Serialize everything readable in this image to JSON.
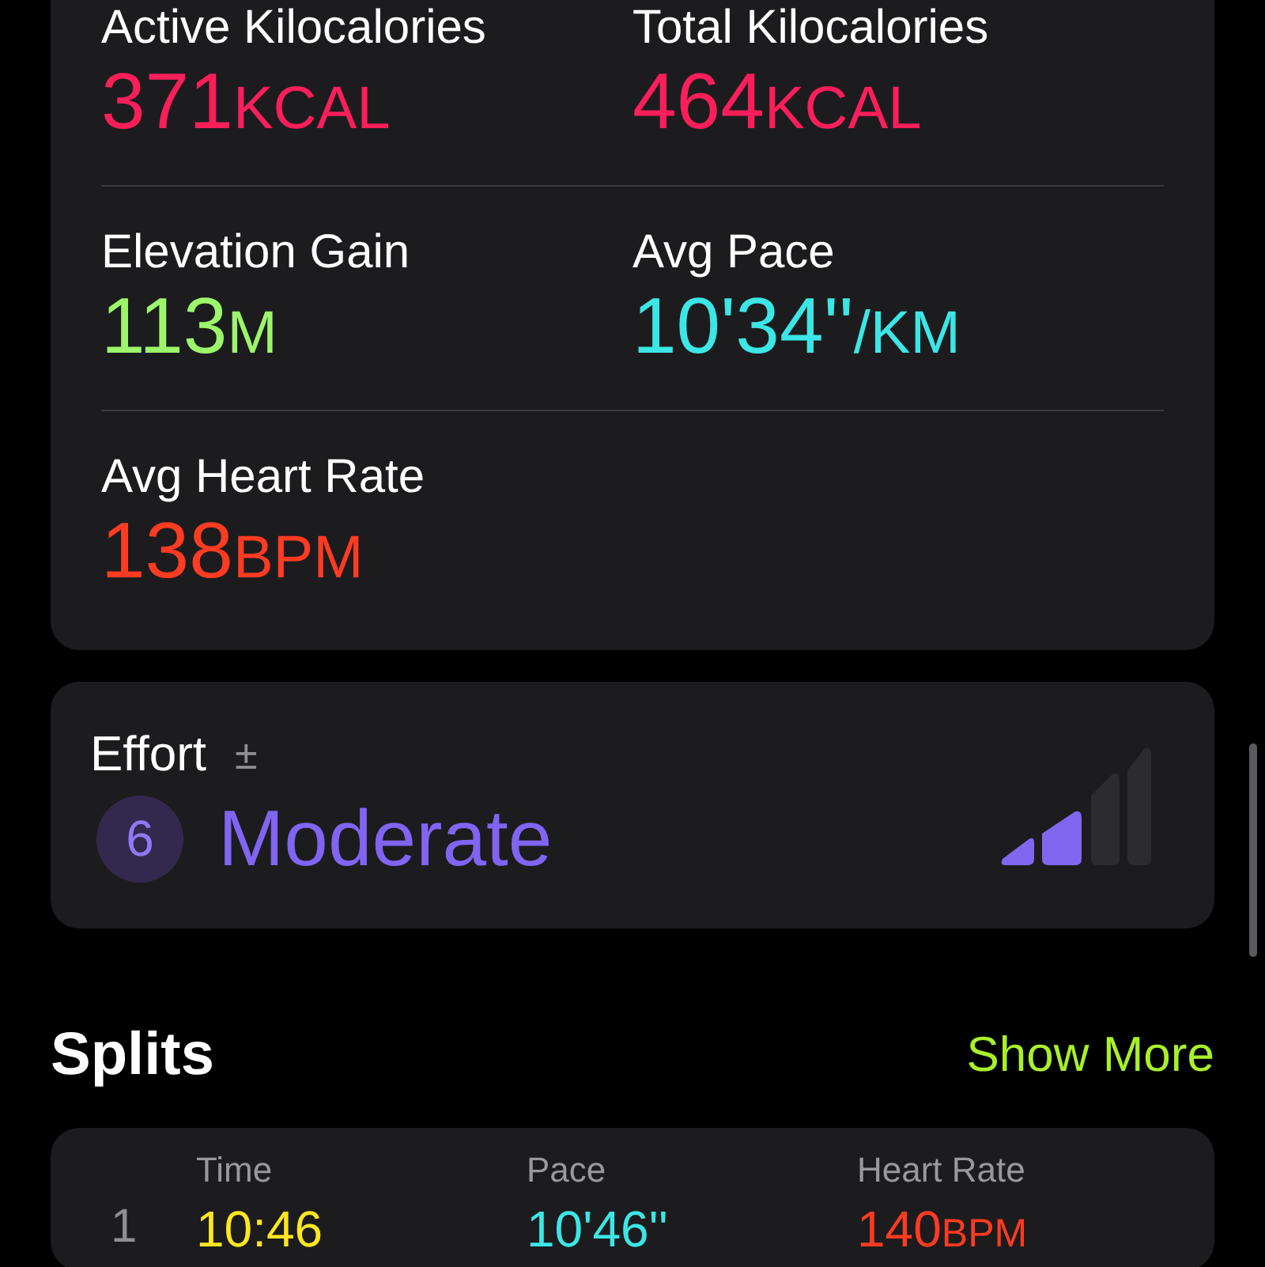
{
  "metrics": [
    {
      "label": "Active Kilocalories",
      "value": "371",
      "unit": "KCAL",
      "color": "#fa1e5a"
    },
    {
      "label": "Total Kilocalories",
      "value": "464",
      "unit": "KCAL",
      "color": "#fa1e5a"
    },
    {
      "label": "Elevation Gain",
      "value": "113",
      "unit": "M",
      "color": "#9cf56a"
    },
    {
      "label": "Avg Pace",
      "value": "10'34''",
      "unit": "/KM",
      "color": "#3ce6e6"
    },
    {
      "label": "Avg Heart Rate",
      "value": "138",
      "unit": "BPM",
      "color": "#ff3b21"
    }
  ],
  "effort": {
    "title": "Effort",
    "adjust_icon": "±",
    "score": "6",
    "label": "Moderate",
    "level": 0.5
  },
  "splits": {
    "title": "Splits",
    "show_more": "Show More",
    "columns": [
      "Time",
      "Pace",
      "Heart Rate"
    ],
    "rows": [
      {
        "index": "1",
        "time": "10:46",
        "pace": "10'46''",
        "heart_rate": "140",
        "heart_rate_unit": "BPM"
      }
    ]
  }
}
